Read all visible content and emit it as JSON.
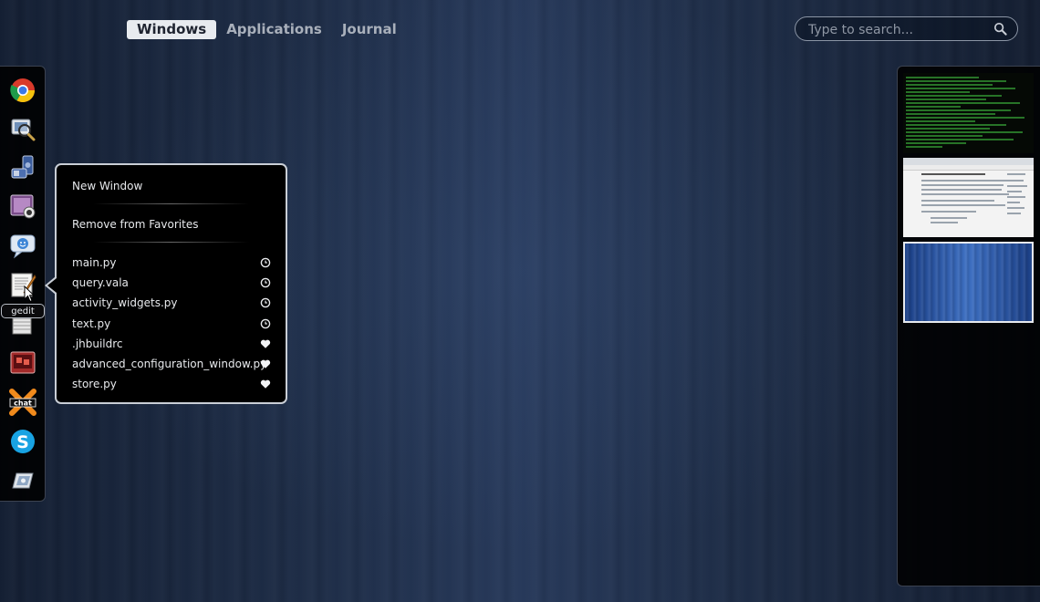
{
  "overview": {
    "tabs": [
      {
        "label": "Windows",
        "active": true
      },
      {
        "label": "Applications",
        "active": false
      },
      {
        "label": "Journal",
        "active": false
      }
    ],
    "search": {
      "placeholder": "Type to search...",
      "value": "",
      "icon": "search-icon"
    }
  },
  "dash": {
    "items": [
      {
        "name": "chrome",
        "icon": "chrome-icon"
      },
      {
        "name": "image-viewer",
        "icon": "magnifier-photo-icon"
      },
      {
        "name": "music-player",
        "icon": "music-icon"
      },
      {
        "name": "media",
        "icon": "webcam-icon"
      },
      {
        "name": "chat",
        "icon": "chat-icon"
      },
      {
        "name": "gedit",
        "icon": "text-editor-icon"
      },
      {
        "name": "archive",
        "icon": "archive-icon"
      },
      {
        "name": "presentation",
        "icon": "presentation-icon"
      },
      {
        "name": "chat-x",
        "icon": "chat-x-icon"
      },
      {
        "name": "skype",
        "icon": "skype-icon"
      },
      {
        "name": "remote-desktop",
        "icon": "remote-desktop-icon"
      }
    ],
    "tooltip": "gedit"
  },
  "context_menu": {
    "new_window": "New Window",
    "remove_favorites": "Remove from Favorites",
    "recent_files": [
      {
        "label": "main.py",
        "icon": "clock-icon"
      },
      {
        "label": "query.vala",
        "icon": "clock-icon"
      },
      {
        "label": "activity_widgets.py",
        "icon": "clock-icon"
      },
      {
        "label": "text.py",
        "icon": "clock-icon"
      },
      {
        "label": ".jhbuildrc",
        "icon": "heart-icon"
      },
      {
        "label": "advanced_configuration_window.py",
        "icon": "heart-icon"
      },
      {
        "label": "store.py",
        "icon": "heart-icon"
      }
    ]
  },
  "workspaces": {
    "thumbnails": [
      {
        "name": "terminal-workspace"
      },
      {
        "name": "document-workspace"
      },
      {
        "name": "empty-workspace",
        "active": true
      }
    ]
  },
  "colors": {
    "background": "#1e2d47",
    "menu_border": "#c9ced6",
    "active_tab": "#e8ebef"
  }
}
